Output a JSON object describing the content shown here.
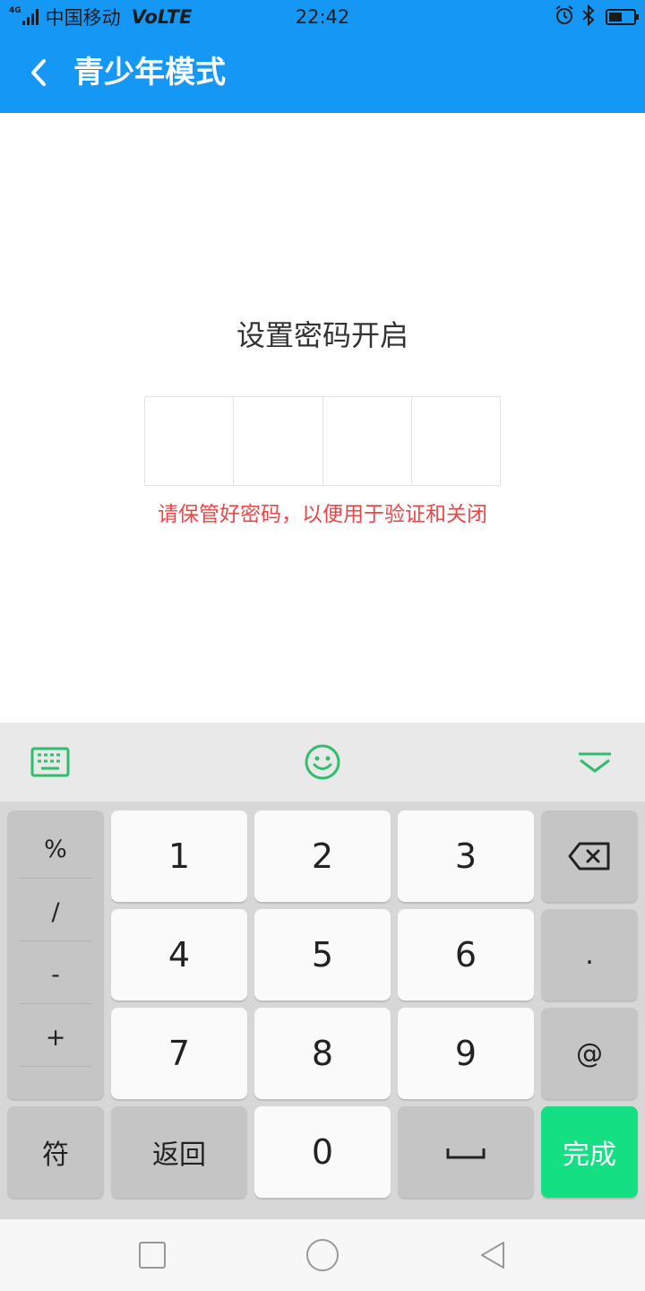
{
  "status_bar": {
    "network": "4G",
    "carrier": "中国移动",
    "volte": "VoLTE",
    "time": "22:42",
    "battery_level": 0.55
  },
  "header": {
    "title": "青少年模式",
    "back_icon": "chevron-left-icon"
  },
  "content": {
    "prompt": "设置密码开启",
    "pin_length": 4,
    "hint": "请保管好密码，以便用于验证和关闭"
  },
  "keyboard": {
    "toolbar": {
      "left_icon": "keyboard-icon",
      "center_icon": "emoji-icon",
      "right_icon": "collapse-keyboard-icon"
    },
    "symbols": [
      "%",
      "/",
      "-",
      "+"
    ],
    "digits": {
      "k1": "1",
      "k2": "2",
      "k3": "3",
      "k4": "4",
      "k5": "5",
      "k6": "6",
      "k7": "7",
      "k8": "8",
      "k9": "9",
      "k0": "0"
    },
    "dot": ".",
    "at": "@",
    "symbol_label": "符",
    "back_label": "返回",
    "done_label": "完成",
    "accent_color": "#15df83"
  },
  "colors": {
    "header": "#1598f5",
    "hint": "#e8474a"
  }
}
